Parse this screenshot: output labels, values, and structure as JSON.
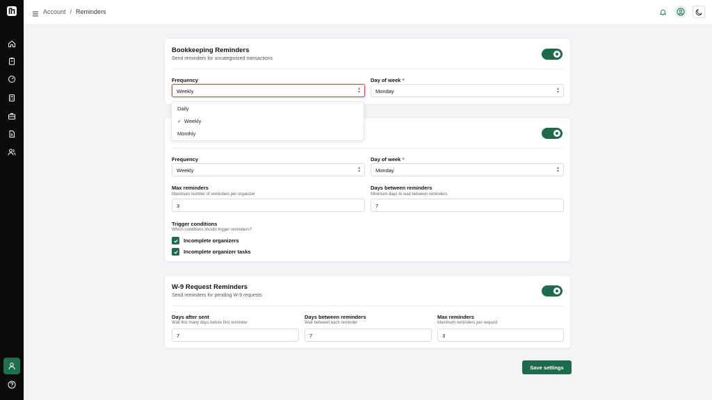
{
  "colors": {
    "accent": "#1e6b4c",
    "sidebar_bg": "#0b0b0c",
    "page_bg": "#f3f4f6",
    "focus_ring": "#c94040"
  },
  "sidebar": {
    "logo_icon": "app-logo-icon",
    "items": [
      {
        "icon": "home-icon"
      },
      {
        "icon": "clipboard-icon"
      },
      {
        "icon": "gauge-icon"
      },
      {
        "icon": "calculator-icon"
      },
      {
        "icon": "briefcase-icon"
      },
      {
        "icon": "document-icon"
      },
      {
        "icon": "users-icon"
      }
    ],
    "active_item_icon": "user-icon",
    "help_icon": "help-circle-icon"
  },
  "header": {
    "menu_icon": "hamburger-icon",
    "breadcrumb": {
      "parent": "Account",
      "separator": "/",
      "current": "Reminders"
    },
    "right_icons": [
      "bell-icon",
      "user-circle-icon",
      "moon-icon"
    ]
  },
  "bookkeeping": {
    "title": "Bookkeeping Reminders",
    "subtitle": "Send reminders for uncategorized transactions",
    "enabled": true,
    "frequency_label": "Frequency",
    "frequency_value": "Weekly",
    "day_label": "Day of week",
    "required_mark": "*",
    "day_value": "Monday",
    "dropdown_options": [
      "Daily",
      "Weekly",
      "Monthly"
    ],
    "dropdown_selected_mark": "✓"
  },
  "organizer": {
    "enabled": true,
    "frequency_label": "Frequency",
    "frequency_value": "Weekly",
    "day_label": "Day of week",
    "required_mark": "*",
    "day_value": "Monday",
    "max_label": "Max reminders",
    "max_help": "Maximum number of reminders per organizer",
    "max_value": "3",
    "days_between_label": "Days between reminders",
    "days_between_help": "Minimum days to wait between reminders",
    "days_between_value": "7",
    "trigger_label": "Trigger conditions",
    "trigger_help": "Which conditions should trigger reminders?",
    "conditions": [
      {
        "label": "Incomplete organizers",
        "checked": true
      },
      {
        "label": "Incomplete organizer tasks",
        "checked": true
      }
    ]
  },
  "w9": {
    "title": "W-9 Request Reminders",
    "subtitle": "Send reminders for pending W-9 requests",
    "enabled": true,
    "after_label": "Days after sent",
    "after_help": "Wait this many days before first reminder",
    "after_value": "7",
    "between_label": "Days between reminders",
    "between_help": "Wait between each reminder",
    "between_value": "7",
    "max_label": "Max reminders",
    "max_help": "Maximum reminders per request",
    "max_value": "3"
  },
  "save_label": "Save settings"
}
